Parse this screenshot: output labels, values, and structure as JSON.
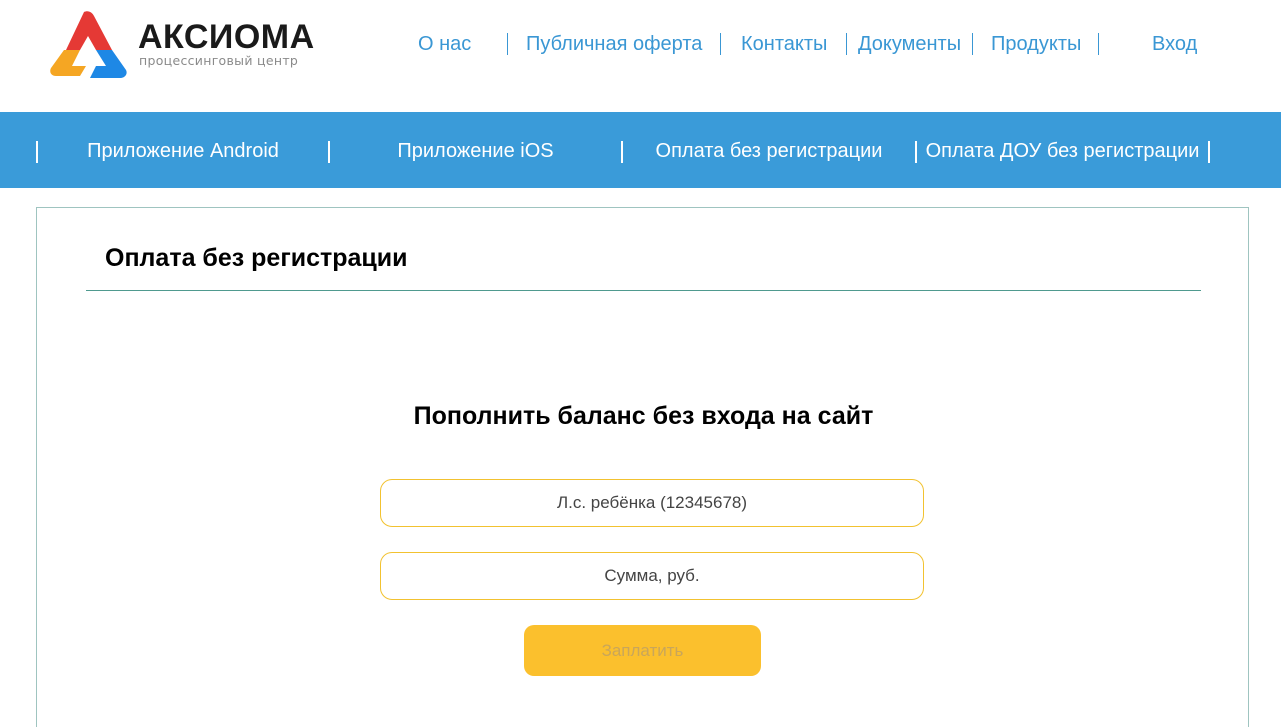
{
  "brand": {
    "name": "АКСИОМА",
    "tagline": "процессинговый центр",
    "colors": {
      "red": "#e53935",
      "orange": "#f5a623",
      "blue": "#1e88e5"
    }
  },
  "top_nav": {
    "items": [
      {
        "label": "О нас"
      },
      {
        "label": "Публичная оферта"
      },
      {
        "label": "Контакты"
      },
      {
        "label": "Документы"
      },
      {
        "label": "Продукты"
      },
      {
        "label": "Вход"
      }
    ],
    "color": "#3a97d4"
  },
  "sub_nav": {
    "items": [
      {
        "label": "Приложение Android"
      },
      {
        "label": "Приложение iOS"
      },
      {
        "label": "Оплата без регистрации"
      },
      {
        "label": "Оплата ДОУ без регистрации"
      }
    ],
    "background": "#3a9bd9"
  },
  "main": {
    "page_title": "Оплата без регистрации",
    "form": {
      "heading": "Пополнить баланс без входа на сайт",
      "account_field": {
        "placeholder": "Л.с. ребёнка (12345678)",
        "value": ""
      },
      "amount_field": {
        "placeholder": "Сумма, руб.",
        "value": ""
      },
      "submit_label": "Заплатить",
      "accent": "#fbc02d"
    }
  }
}
